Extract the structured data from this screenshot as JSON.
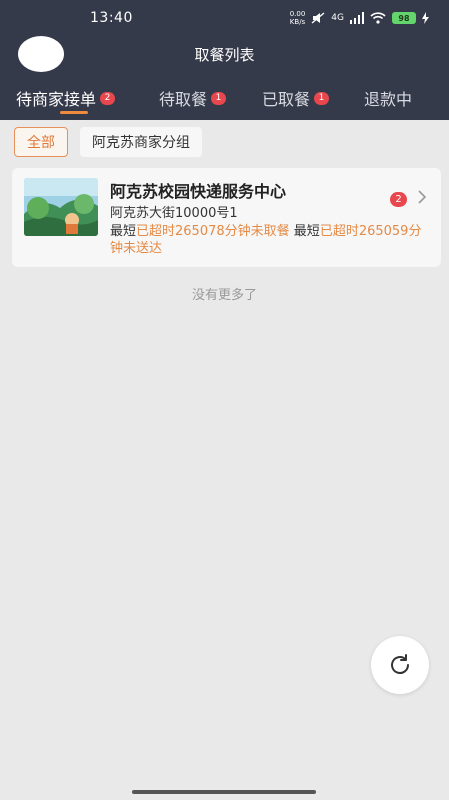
{
  "status_bar": {
    "time": "13:40",
    "net_speed_value": "0.00",
    "net_speed_unit": "KB/s",
    "network_type": "4G",
    "battery": "98"
  },
  "header": {
    "title": "取餐列表"
  },
  "tabs": [
    {
      "label": "待商家接单",
      "badge": "2",
      "active": true
    },
    {
      "label": "待取餐",
      "badge": "1",
      "active": false
    },
    {
      "label": "已取餐",
      "badge": "1",
      "active": false
    },
    {
      "label": "退款中",
      "badge": "",
      "active": false
    }
  ],
  "filters": [
    {
      "label": "全部",
      "selected": true
    },
    {
      "label": "阿克苏商家分组",
      "selected": false
    }
  ],
  "store": {
    "name": "阿克苏校园快递服务中心",
    "address": "阿克苏大街10000号1",
    "pickup_prefix": "最短",
    "pickup_warning": "已超时265078分钟未取餐",
    "delivery_prefix": "最短",
    "delivery_warning": "已超时265059分钟未送达",
    "badge": "2"
  },
  "list_end_text": "没有更多了",
  "colors": {
    "header_bg": "#353a4a",
    "accent": "#f08a3c",
    "badge_red": "#e8474e",
    "warning_orange": "#e48a45",
    "page_bg": "#e9e9e9"
  },
  "icons": {
    "refresh": "refresh-icon",
    "chevron": "chevron-right-icon"
  }
}
